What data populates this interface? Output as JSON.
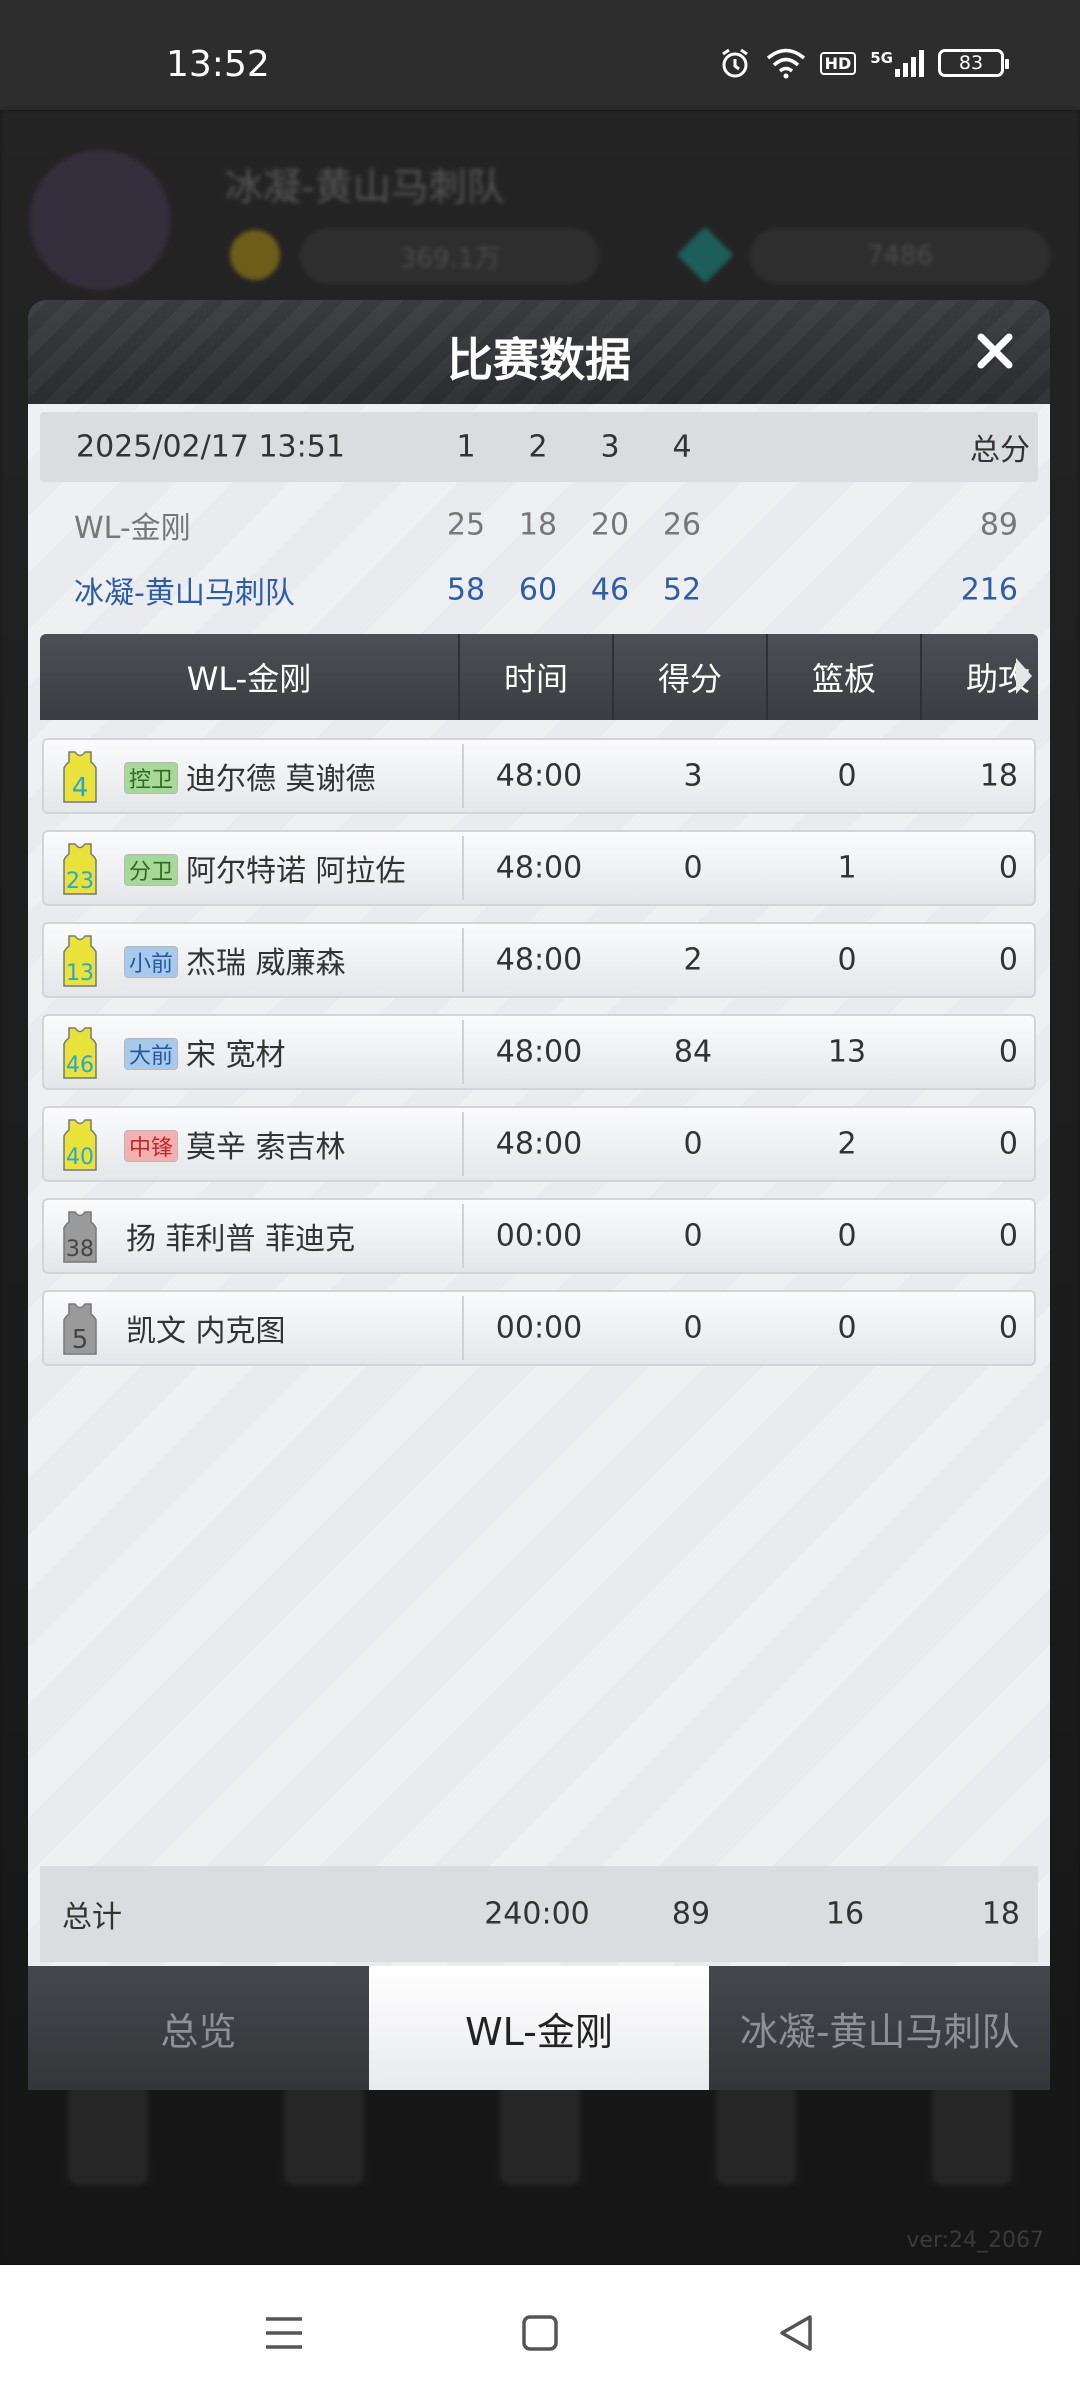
{
  "status_bar": {
    "time": "13:52",
    "battery": "83",
    "network": "5G",
    "hd": "HD"
  },
  "background": {
    "team_name": "冰凝-黄山马刺队",
    "coins": "369.1万",
    "gems": "7486"
  },
  "dialog": {
    "title": "比赛数据",
    "score": {
      "date": "2025/02/17 13:51",
      "quarters": [
        "1",
        "2",
        "3",
        "4"
      ],
      "total_label": "总分",
      "teams": [
        {
          "name": "WL-金刚",
          "q": [
            "25",
            "18",
            "20",
            "26"
          ],
          "total": "89"
        },
        {
          "name": "冰凝-黄山马刺队",
          "q": [
            "58",
            "60",
            "46",
            "52"
          ],
          "total": "216"
        }
      ]
    },
    "table": {
      "team": "WL-金刚",
      "columns": [
        "时间",
        "得分",
        "篮板",
        "助攻"
      ],
      "rows": [
        {
          "number": "4",
          "position": "控卫",
          "name": "迪尔德 莫谢德",
          "time": "48:00",
          "points": "3",
          "rebounds": "0",
          "assists": "18"
        },
        {
          "number": "23",
          "position": "分卫",
          "name": "阿尔特诺 阿拉佐",
          "time": "48:00",
          "points": "0",
          "rebounds": "1",
          "assists": "0"
        },
        {
          "number": "13",
          "position": "小前",
          "name": "杰瑞 威廉森",
          "time": "48:00",
          "points": "2",
          "rebounds": "0",
          "assists": "0"
        },
        {
          "number": "46",
          "position": "大前",
          "name": "宋 宽材",
          "time": "48:00",
          "points": "84",
          "rebounds": "13",
          "assists": "0"
        },
        {
          "number": "40",
          "position": "中锋",
          "name": "莫辛 索吉林",
          "time": "48:00",
          "points": "0",
          "rebounds": "2",
          "assists": "0"
        },
        {
          "number": "38",
          "position": "",
          "name": "扬 菲利普 菲迪克",
          "time": "00:00",
          "points": "0",
          "rebounds": "0",
          "assists": "0"
        },
        {
          "number": "5",
          "position": "",
          "name": "凯文 内克图",
          "time": "00:00",
          "points": "0",
          "rebounds": "0",
          "assists": "0"
        }
      ],
      "total": {
        "label": "总计",
        "time": "240:00",
        "points": "89",
        "rebounds": "16",
        "assists": "18"
      }
    },
    "tabs": [
      {
        "label": "总览",
        "active": false
      },
      {
        "label": "WL-金刚",
        "active": true
      },
      {
        "label": "冰凝-黄山马刺队",
        "active": false
      }
    ]
  },
  "version": "ver:24_2067",
  "colors": {
    "accent_blue": "#2e5da8",
    "jersey_yellow": "#e8e23a",
    "jersey_grey": "#9a9a9a"
  }
}
